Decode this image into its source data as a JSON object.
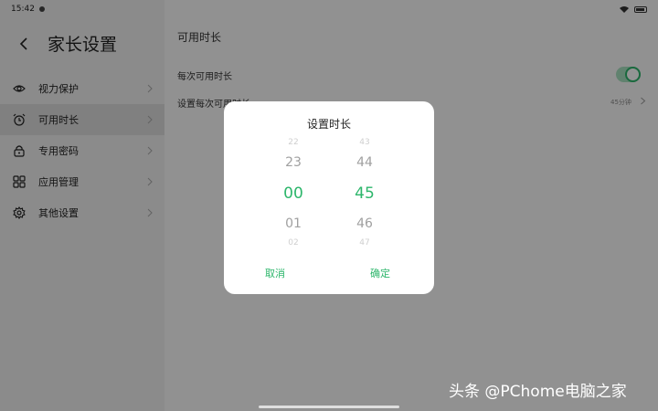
{
  "status": {
    "time": "15:42"
  },
  "header": {
    "title": "家长设置"
  },
  "sidebar": {
    "items": [
      {
        "label": "视力保护",
        "icon": "eye-icon"
      },
      {
        "label": "可用时长",
        "icon": "alarm-clock-icon",
        "active": true
      },
      {
        "label": "专用密码",
        "icon": "lock-icon"
      },
      {
        "label": "应用管理",
        "icon": "apps-grid-icon"
      },
      {
        "label": "其他设置",
        "icon": "gear-icon"
      }
    ]
  },
  "main": {
    "section_title": "可用时长",
    "row1": {
      "label": "每次可用时长",
      "toggle_on": true
    },
    "row2": {
      "label": "设置每次可用时长",
      "value": "45分钟"
    }
  },
  "dialog": {
    "title": "设置时长",
    "hours": {
      "above2": "22",
      "above1": "23",
      "selected": "00",
      "below1": "01",
      "below2": "02"
    },
    "minutes": {
      "above2": "43",
      "above1": "44",
      "selected": "45",
      "below1": "46",
      "below2": "47"
    },
    "cancel_label": "取消",
    "confirm_label": "确定"
  },
  "watermark": "头条 @PChome电脑之家",
  "colors": {
    "accent": "#2db66b"
  }
}
